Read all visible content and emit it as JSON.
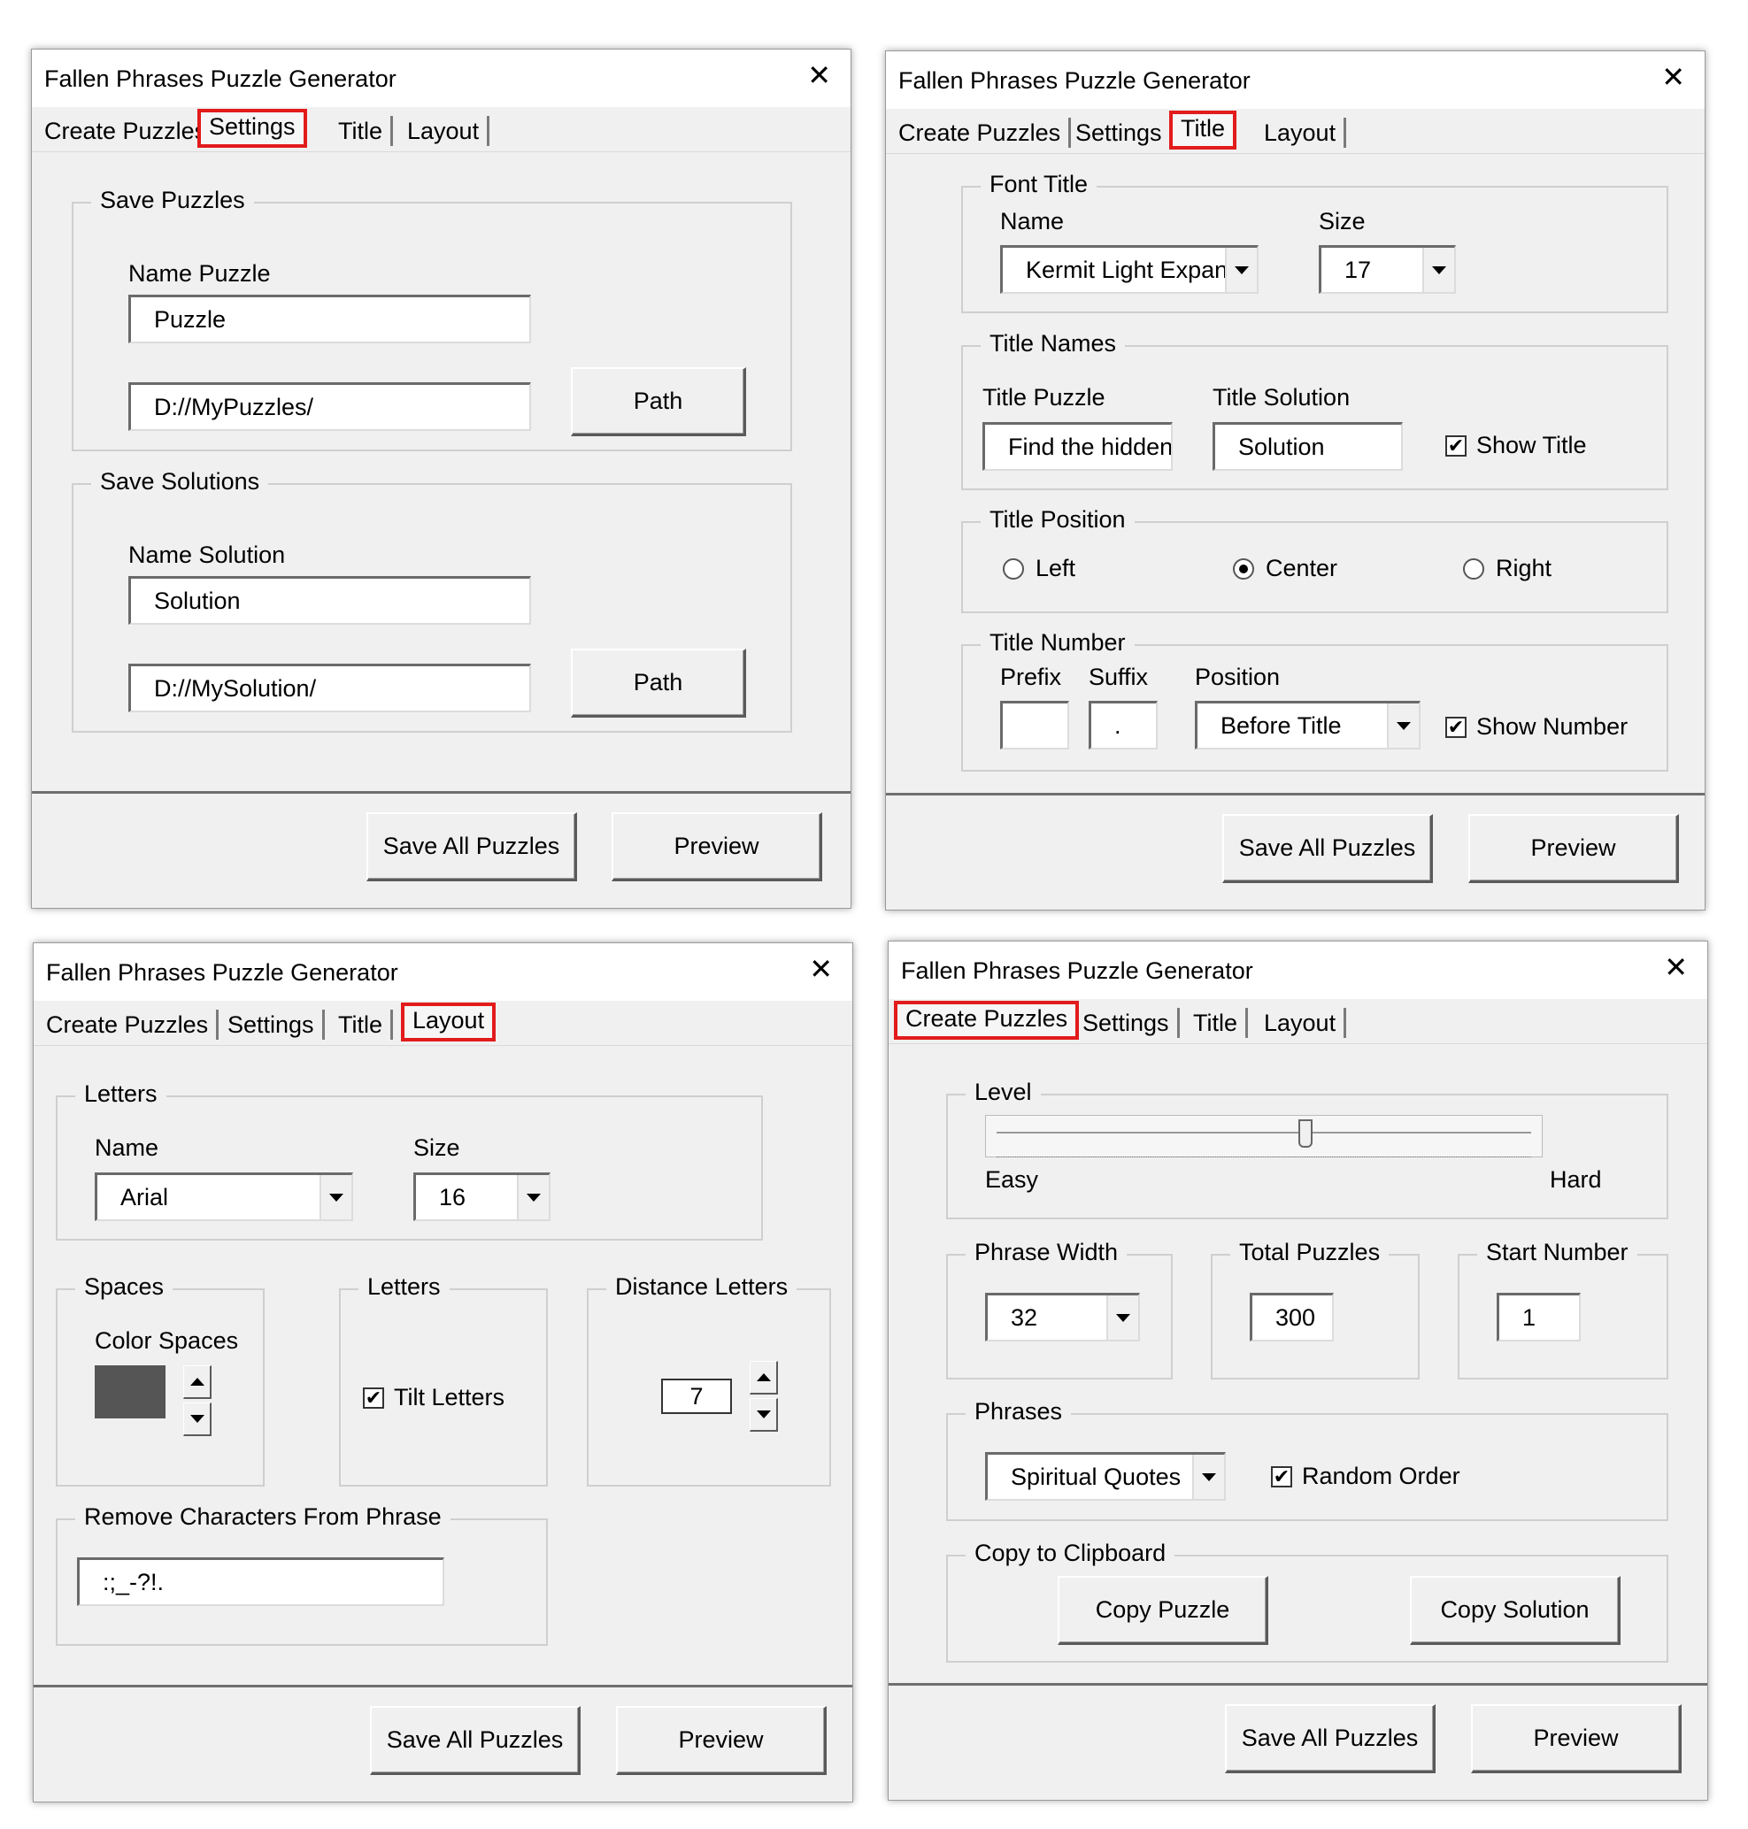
{
  "app_title": "Fallen Phrases Puzzle Generator",
  "close_glyph": "✕",
  "tabs": [
    "Create Puzzles",
    "Settings",
    "Title",
    "Layout"
  ],
  "footer": {
    "save_all": "Save All Puzzles",
    "preview": "Preview"
  },
  "settings": {
    "save_puzzles": {
      "legend": "Save Puzzles",
      "name_label": "Name Puzzle",
      "name_value": "Puzzle",
      "path_value": "D://MyPuzzles/",
      "path_button": "Path"
    },
    "save_solutions": {
      "legend": "Save Solutions",
      "name_label": "Name Solution",
      "name_value": "Solution",
      "path_value": "D://MySolution/",
      "path_button": "Path"
    }
  },
  "title_tab": {
    "font_title": {
      "legend": "Font Title",
      "name_label": "Name",
      "name_value": "Kermit Light Expan",
      "size_label": "Size",
      "size_value": "17"
    },
    "title_names": {
      "legend": "Title Names",
      "puzzle_label": "Title Puzzle",
      "puzzle_value": "Find the hidden",
      "solution_label": "Title Solution",
      "solution_value": "Solution",
      "show_title": "Show Title",
      "show_title_checked": true
    },
    "title_position": {
      "legend": "Title Position",
      "options": [
        "Left",
        "Center",
        "Right"
      ],
      "selected": "Center"
    },
    "title_number": {
      "legend": "Title Number",
      "prefix_label": "Prefix",
      "prefix_value": "",
      "suffix_label": "Suffix",
      "suffix_value": ".",
      "position_label": "Position",
      "position_value": "Before Title",
      "show_number": "Show Number",
      "show_number_checked": true
    }
  },
  "layout_tab": {
    "letters_font": {
      "legend": "Letters",
      "name_label": "Name",
      "name_value": "Arial",
      "size_label": "Size",
      "size_value": "16"
    },
    "spaces": {
      "legend": "Spaces",
      "color_label": "Color Spaces",
      "color": "#555555"
    },
    "letters_opts": {
      "legend": "Letters",
      "tilt": "Tilt Letters",
      "tilt_checked": true
    },
    "distance": {
      "legend": "Distance Letters",
      "value": "7"
    },
    "remove": {
      "legend": "Remove Characters From Phrase",
      "value": ":;_-?!."
    }
  },
  "create_tab": {
    "level": {
      "legend": "Level",
      "easy": "Easy",
      "hard": "Hard",
      "position": 0.58
    },
    "phrase_width": {
      "legend": "Phrase Width",
      "value": "32"
    },
    "total_puzzles": {
      "legend": "Total Puzzles",
      "value": "300"
    },
    "start_number": {
      "legend": "Start Number",
      "value": "1"
    },
    "phrases": {
      "legend": "Phrases",
      "value": "Spiritual Quotes",
      "random": "Random Order",
      "random_checked": true
    },
    "clipboard": {
      "legend": "Copy to Clipboard",
      "copy_puzzle": "Copy Puzzle",
      "copy_solution": "Copy Solution"
    }
  },
  "colors": {
    "highlight": "#e21b1b",
    "window_bg": "#f0f0f0"
  }
}
